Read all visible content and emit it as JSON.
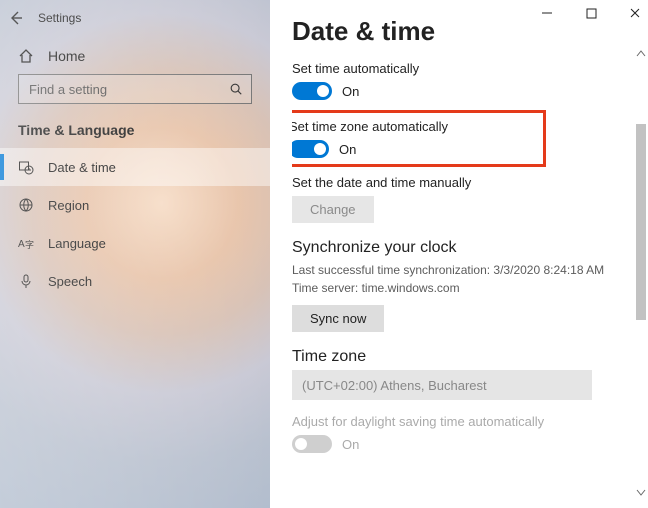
{
  "window": {
    "title": "Settings"
  },
  "sidebar": {
    "home": "Home",
    "search_placeholder": "Find a setting",
    "section": "Time & Language",
    "items": [
      {
        "label": "Date & time"
      },
      {
        "label": "Region"
      },
      {
        "label": "Language"
      },
      {
        "label": "Speech"
      }
    ]
  },
  "main": {
    "title": "Date & time",
    "set_time_auto": {
      "label": "Set time automatically",
      "state": "On"
    },
    "set_tz_auto": {
      "label": "Set time zone automatically",
      "state": "On"
    },
    "manual": {
      "label": "Set the date and time manually",
      "button": "Change"
    },
    "sync": {
      "heading": "Synchronize your clock",
      "last": "Last successful time synchronization: 3/3/2020 8:24:18 AM",
      "server": "Time server: time.windows.com",
      "button": "Sync now"
    },
    "timezone": {
      "heading": "Time zone",
      "value": "(UTC+02:00) Athens, Bucharest"
    },
    "dst": {
      "label": "Adjust for daylight saving time automatically",
      "state": "On"
    }
  }
}
